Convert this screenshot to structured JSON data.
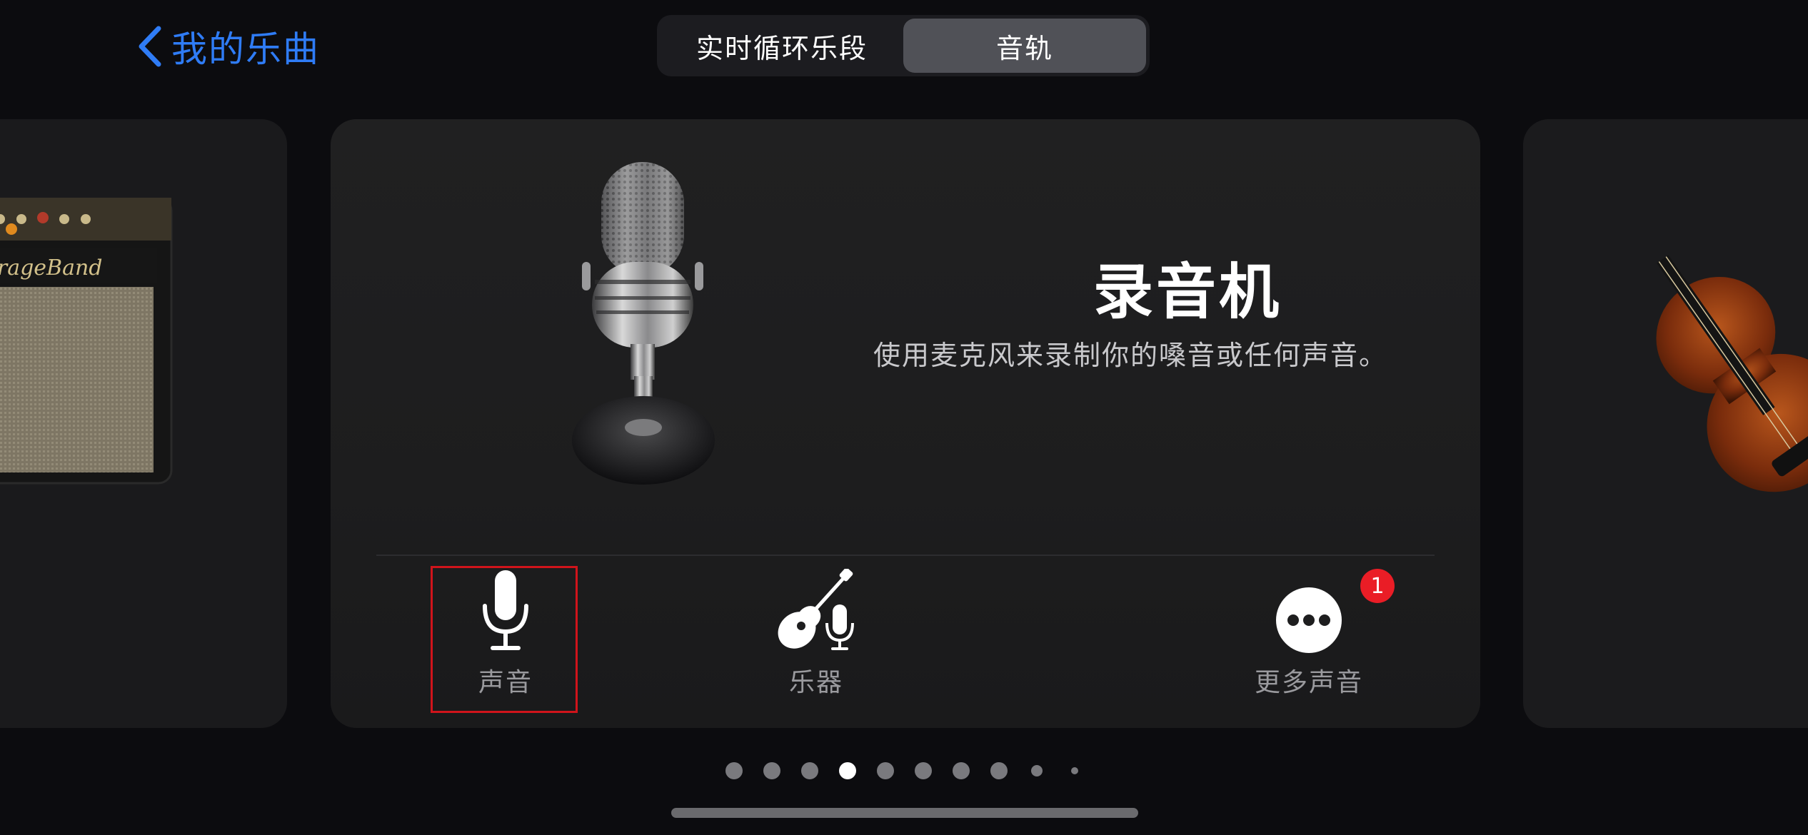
{
  "nav": {
    "back_label": "我的乐曲"
  },
  "segmented": {
    "options": [
      "实时循环乐段",
      "音轨"
    ],
    "selected": "音轨"
  },
  "card": {
    "title": "录音机",
    "description": "使用麦克风来录制你的嗓音或任何声音。",
    "options": [
      {
        "label": "声音",
        "icon": "microphone-icon",
        "selected": true
      },
      {
        "label": "乐器",
        "icon": "guitar-microphone-icon"
      },
      {
        "label": "更多声音",
        "icon": "more-icon",
        "badge": "1"
      }
    ]
  },
  "side_cards": {
    "left_brand_text": "GarageBand"
  },
  "pager": {
    "count": 10,
    "active_index": 3
  },
  "colors": {
    "accent": "#2f7cf6",
    "badge": "#ea1d26",
    "highlight": "#d0141b"
  }
}
